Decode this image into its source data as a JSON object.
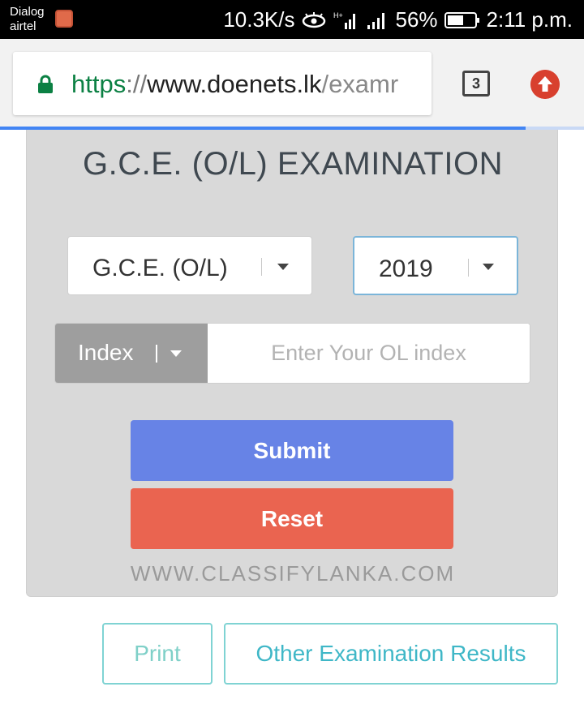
{
  "status_bar": {
    "carrier_1": "Dialog",
    "carrier_2": "airtel",
    "speed": "10.3K/s",
    "network_type": "H+",
    "battery": "56%",
    "time": "2:11 p.m."
  },
  "browser": {
    "url_scheme": "https",
    "url_sep": "://",
    "url_host": "www.doenets.lk",
    "url_path": "/examr",
    "tab_count": "3"
  },
  "form": {
    "title": "G.C.E. (O/L) EXAMINATION",
    "exam_select_value": "G.C.E. (O/L)",
    "year_select_value": "2019",
    "index_type": "Index",
    "index_placeholder": "Enter Your OL index",
    "submit_label": "Submit",
    "reset_label": "Reset",
    "watermark": "WWW.CLASSIFYLANKA.COM"
  },
  "footer": {
    "print_label": "Print",
    "other_results_label": "Other Examination Results"
  },
  "colors": {
    "submit": "#6783e6",
    "reset": "#ea6450",
    "secure_green": "#0b8043",
    "outline_teal": "#3fb7c7"
  }
}
